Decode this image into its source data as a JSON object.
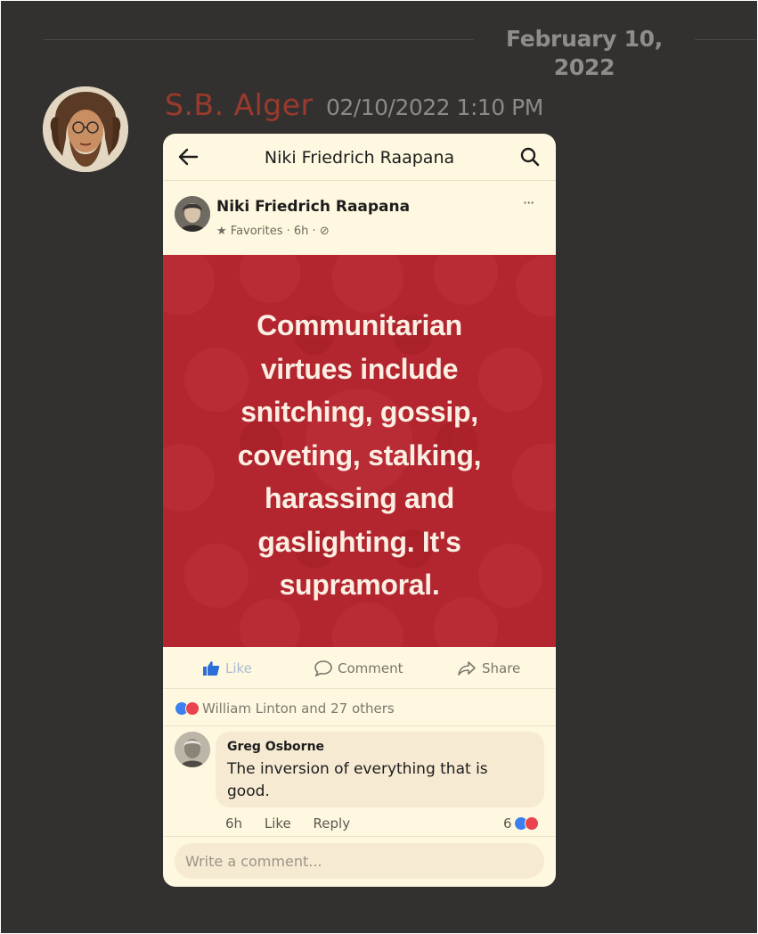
{
  "chat": {
    "date_divider": "February 10, 2022",
    "message": {
      "username": "S.B. Alger",
      "timestamp": "02/10/2022 1:10 PM",
      "username_color": "#9b3a2c"
    }
  },
  "facebook_post": {
    "topbar": {
      "title": "Niki Friedrich Raapana",
      "back_icon": "arrow-left-icon",
      "search_icon": "search-icon"
    },
    "post": {
      "author": "Niki Friedrich Raapana",
      "meta": "★ Favorites · 6h · ⊘",
      "more": "···",
      "quote_lines": [
        "Communitarian",
        "virtues include",
        "snitching, gossip,",
        "coveting, stalking,",
        "harassing and",
        "gaslighting. It's",
        "supramoral."
      ],
      "image_bg_color": "#b3262f"
    },
    "actions": {
      "like": "Like",
      "comment": "Comment",
      "share": "Share"
    },
    "reactions": {
      "text": "William Linton and 27 others"
    },
    "comment": {
      "author": "Greg Osborne",
      "text": "The inversion of everything that is good.",
      "time": "6h",
      "like": "Like",
      "reply": "Reply",
      "reaction_count": "6"
    },
    "write_comment": {
      "placeholder": "Write a comment..."
    }
  }
}
